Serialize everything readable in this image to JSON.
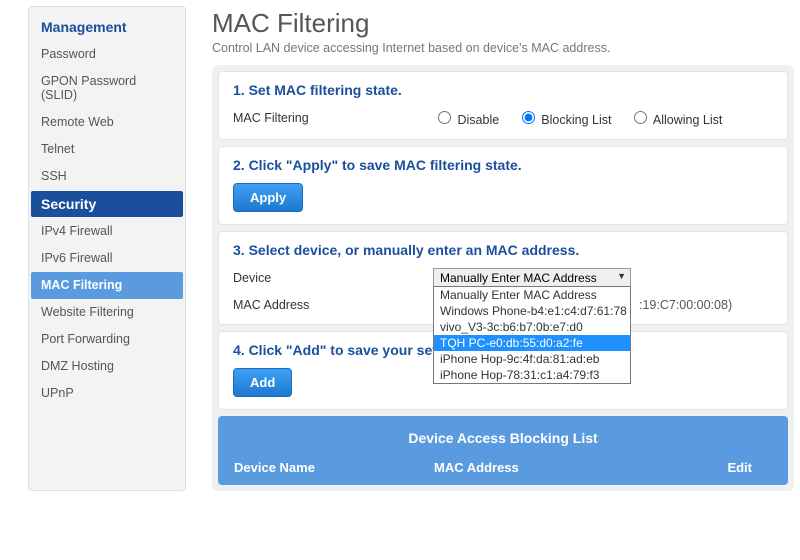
{
  "sidebar": {
    "heading1": "Management",
    "items1": [
      {
        "label": "Password"
      },
      {
        "label": "GPON Password (SLID)"
      },
      {
        "label": "Remote Web"
      },
      {
        "label": "Telnet"
      },
      {
        "label": "SSH"
      }
    ],
    "heading2": "Security",
    "items2": [
      {
        "label": "IPv4 Firewall"
      },
      {
        "label": "IPv6 Firewall"
      },
      {
        "label": "MAC Filtering"
      },
      {
        "label": "Website Filtering"
      },
      {
        "label": "Port Forwarding"
      },
      {
        "label": "DMZ Hosting"
      },
      {
        "label": "UPnP"
      }
    ]
  },
  "page": {
    "title": "MAC Filtering",
    "subtitle": "Control LAN device accessing Internet based on device's MAC address."
  },
  "sec1": {
    "heading": "1. Set MAC filtering state.",
    "label": "MAC Filtering",
    "opts": {
      "disable": "Disable",
      "block": "Blocking List",
      "allow": "Allowing List"
    },
    "selected": "block"
  },
  "sec2": {
    "heading": "2. Click \"Apply\" to save MAC filtering state.",
    "btn": "Apply"
  },
  "sec3": {
    "heading": "3. Select device, or manually enter an MAC address.",
    "device_label": "Device",
    "mac_label": "MAC Address",
    "select_value": "Manually Enter MAC Address",
    "options": [
      "Manually Enter MAC Address",
      "Windows Phone-b4:e1:c4:d7:61:78",
      "vivo_V3-3c:b6:b7:0b:e7:d0",
      "TQH PC-e0:db:55:d0:a2:fe",
      "iPhone Hop-9c:4f:da:81:ad:eb",
      "iPhone Hop-78:31:c1:a4:79:f3"
    ],
    "highlight_index": 3,
    "mac_example": ":19:C7:00:00:08)"
  },
  "sec4": {
    "heading": "4. Click \"Add\" to save your sett",
    "btn": "Add"
  },
  "list": {
    "title": "Device Access Blocking List",
    "cols": {
      "name": "Device Name",
      "mac": "MAC Address",
      "edit": "Edit"
    }
  }
}
